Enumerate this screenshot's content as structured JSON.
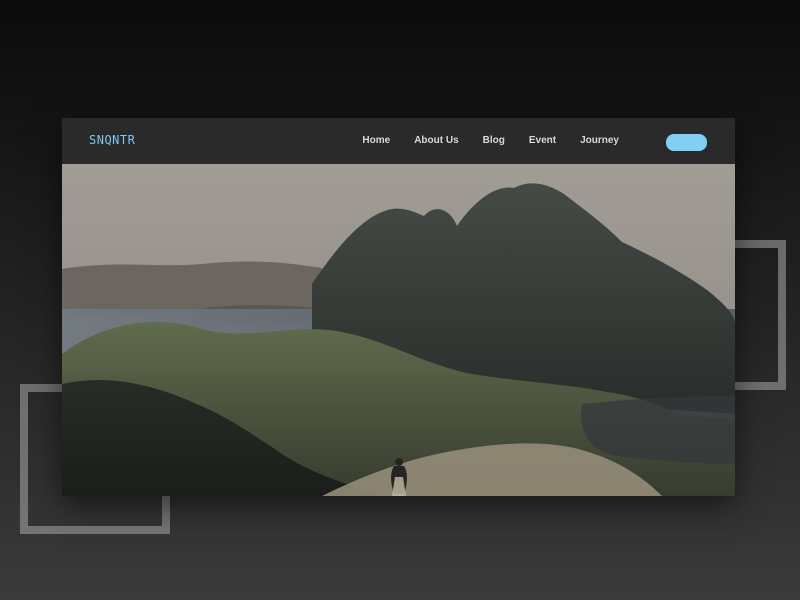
{
  "brand": {
    "logo": "SNQNTR"
  },
  "nav": {
    "items": [
      "Home",
      "About Us",
      "Blog",
      "Event",
      "Journey"
    ],
    "cta_label": ""
  },
  "colors": {
    "accent": "#81d0f4",
    "logo": "#7cc7ef"
  },
  "hero": {
    "image_description": ""
  }
}
